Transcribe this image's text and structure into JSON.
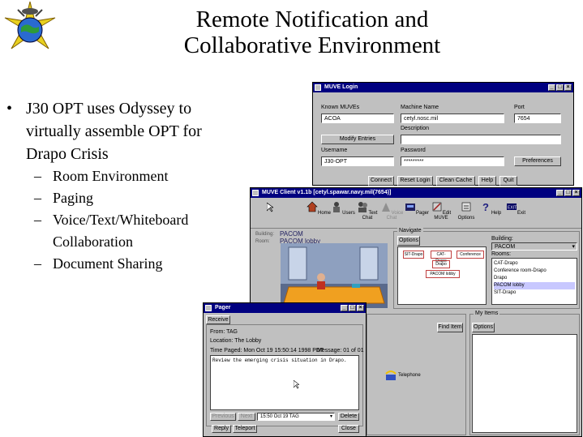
{
  "slide": {
    "title_line1": "Remote Notification and",
    "title_line2": "Collaborative Environment",
    "bullet": "J30 OPT uses Odyssey to virtually assemble OPT for Drapo Crisis",
    "sub_bullets": [
      "Room Environment",
      "Paging",
      "Voice/Text/Whiteboard Collaboration",
      "Document Sharing"
    ]
  },
  "login_window": {
    "title": "MUVE Login",
    "known_label": "Known MUVEs",
    "known_value": "ACOA",
    "machine_label": "Machine Name",
    "machine_value": "cetyl.nosc.mil",
    "port_label": "Port",
    "port_value": "7654",
    "description_label": "Description",
    "modify_button": "Modify Entries",
    "username_label": "Username",
    "username_value": "J30-OPT",
    "password_label": "Password",
    "password_value": "*********",
    "preferences_button": "Preferences",
    "buttons": [
      "Connect",
      "Reset Login",
      "Clean Cache",
      "Help",
      "Quit"
    ]
  },
  "client_window": {
    "title": "MUVE Client v1.1b  [cetyl.spawar.navy.mil(7654)]",
    "toolbar": [
      "Home",
      "Users",
      "Text Chat",
      "Voice Chat",
      "Pager",
      "Edit MUVE",
      "Options",
      "Help",
      "Exit"
    ],
    "building_label": "Building:",
    "building_value": "PACOM",
    "room_label": "Room:",
    "room_value": "PACOM lobby",
    "navigate_label": "Navigate",
    "options_button": "Options",
    "map_rooms": [
      "SIT-Drapo",
      "CAT-Drapo",
      "Conference ro...",
      "Drapo",
      "PACOM lobby"
    ],
    "building_select_label": "Building:",
    "building_select_value": "PACOM",
    "rooms_label": "Rooms:",
    "rooms": [
      "CAT-Drapo",
      "Conference room-Drapo",
      "Drapo",
      "PACOM lobby",
      "SIT-Drapo"
    ],
    "selected_room": "PACOM lobby",
    "find_item_button": "Find Item",
    "my_items_label": "My Items",
    "my_items_options": "Options",
    "item_label": "Telephone"
  },
  "pager_window": {
    "title": "Pager",
    "receive_tab": "Receive",
    "from": "From: TAG",
    "location": "Location: The Lobby",
    "time": "Time Paged: Mon Oct 19 15:50:14 1998 PDT",
    "message_count": "Message:  01 of 01",
    "message_body": "Review the emerging crisis situation in Drapo.",
    "prev_button": "Previous",
    "next_button": "Next",
    "message_select": "15:50 Oct 19 TAG",
    "delete_button": "Delete",
    "reply_button": "Reply",
    "teleport_button": "Teleport",
    "close_button": "Close"
  },
  "colors": {
    "titlebar": "#000080",
    "window": "#c0c0c0",
    "selection": "#c8c8ff"
  }
}
